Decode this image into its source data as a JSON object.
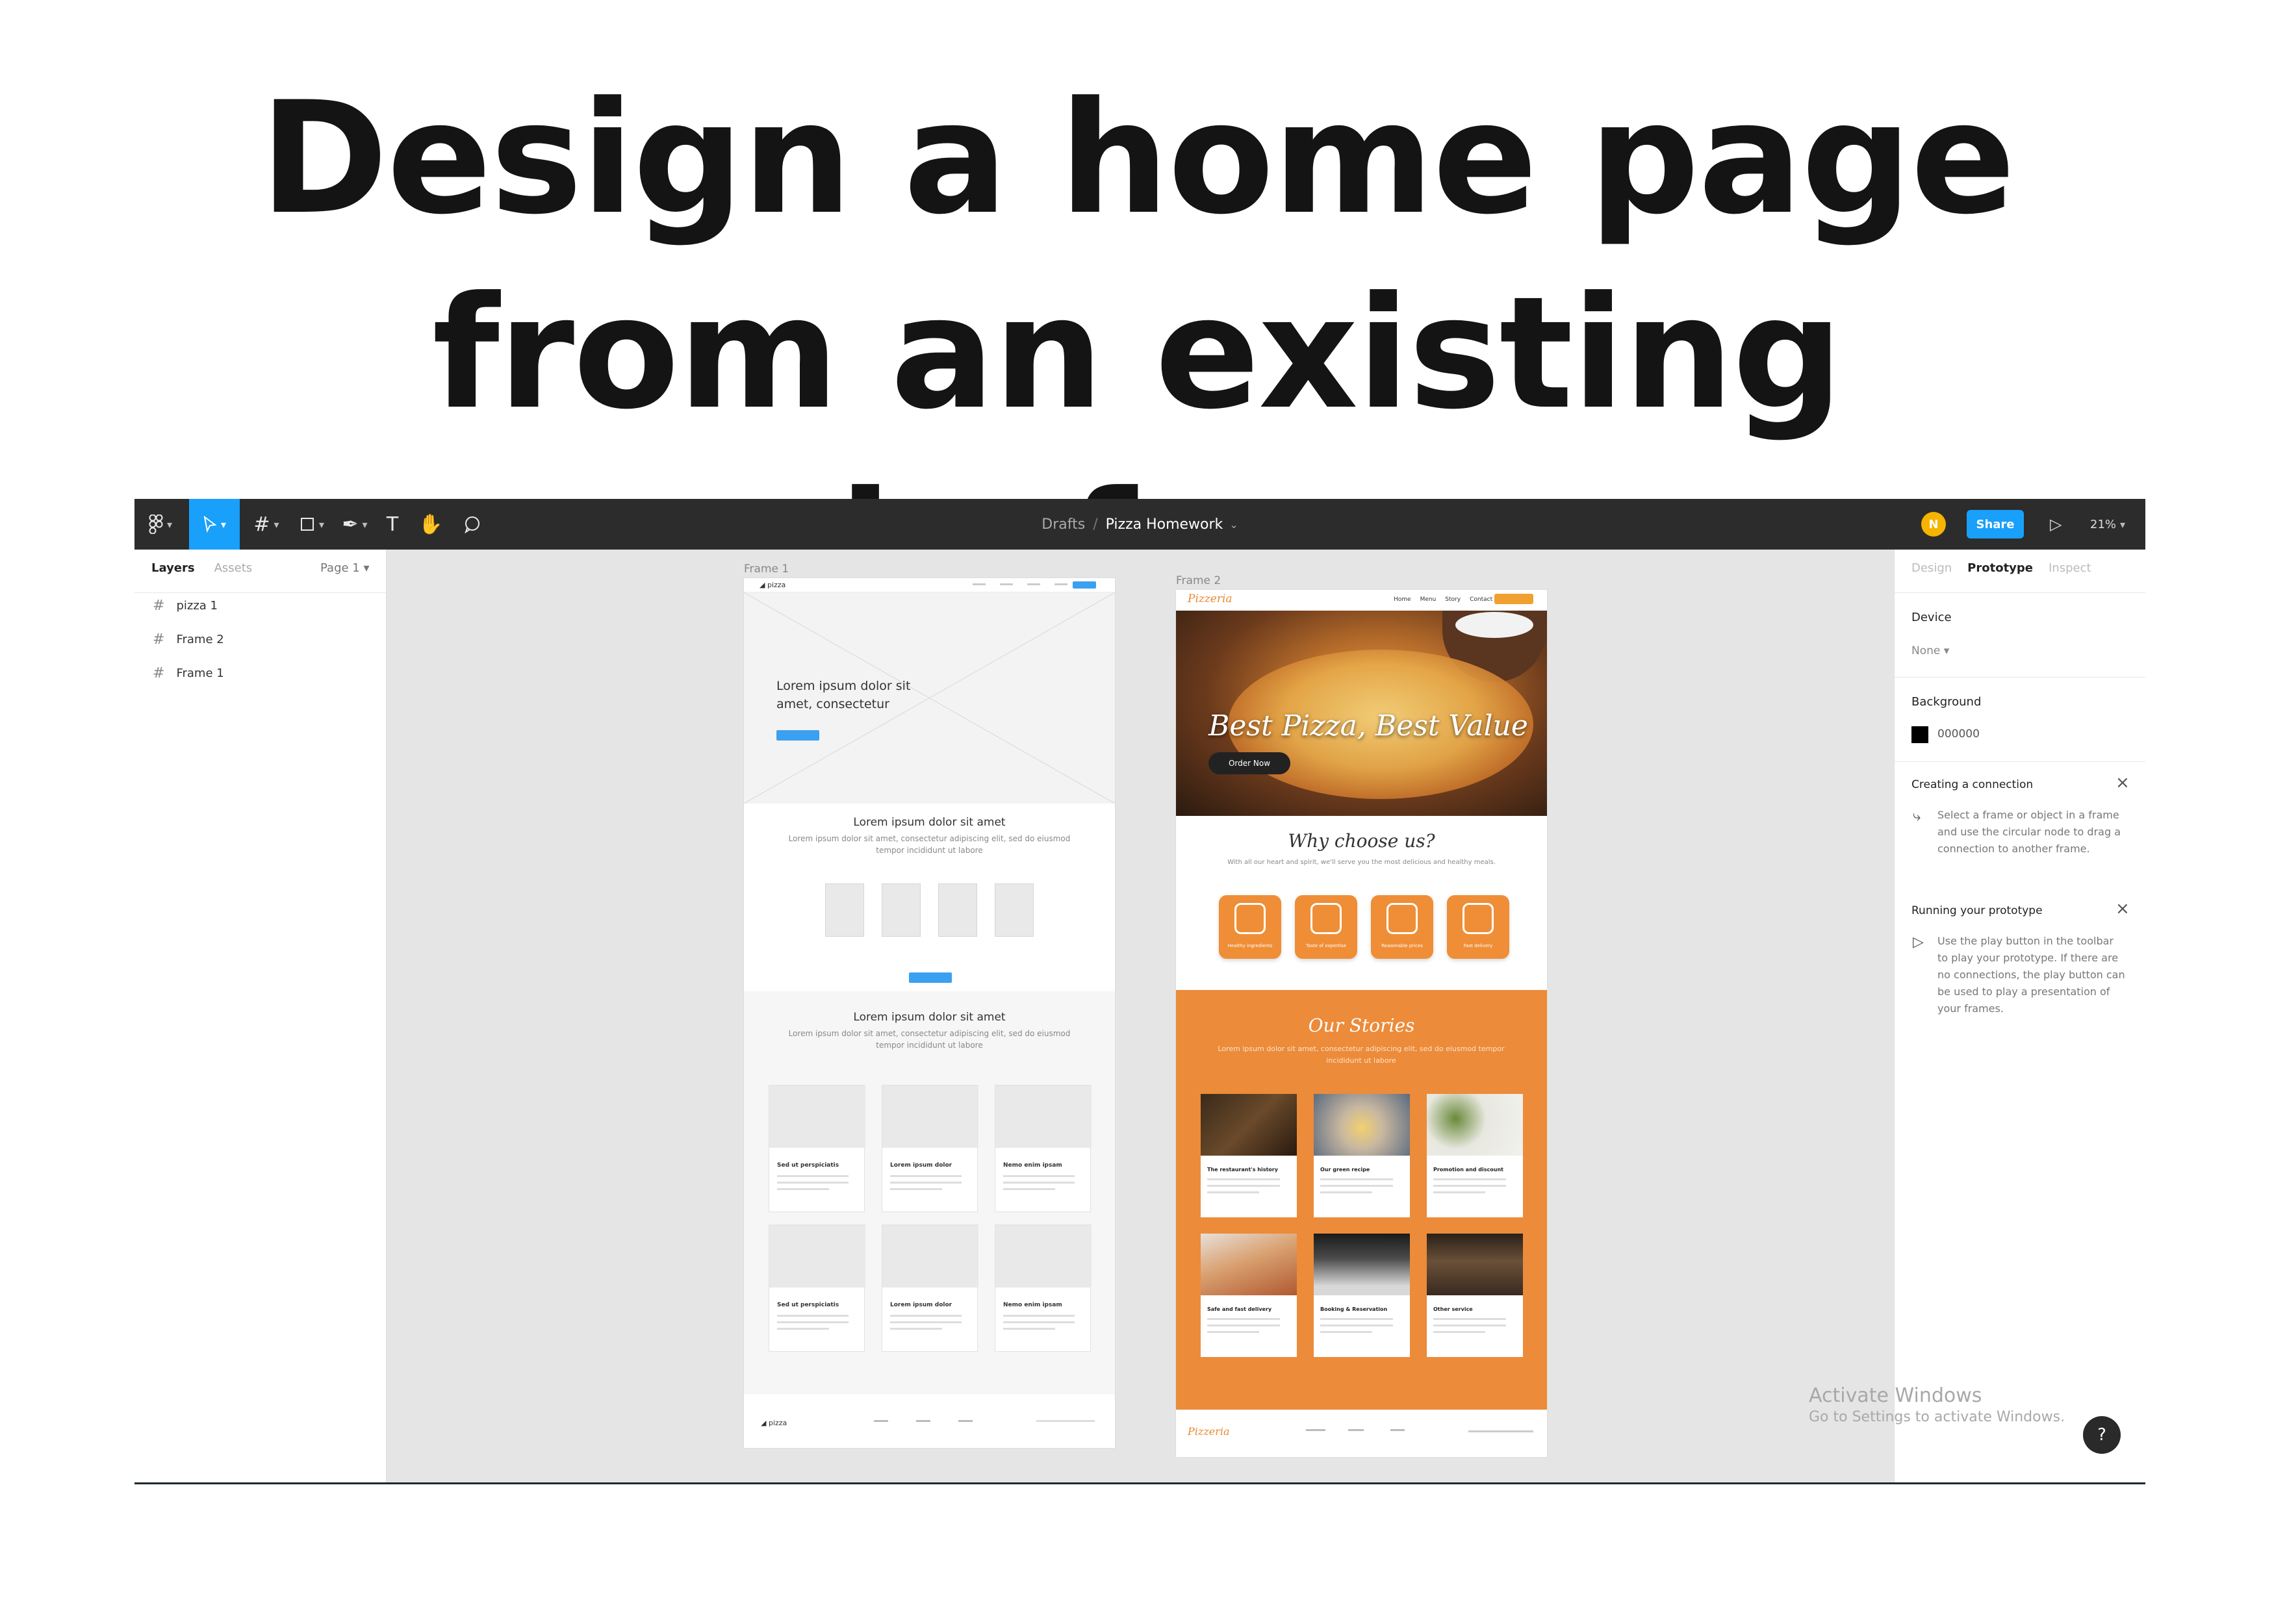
{
  "headline": {
    "line1": "Design a home page",
    "line2": "from an existing wireframe"
  },
  "toolbar": {
    "breadcrumb_root": "Drafts",
    "breadcrumb_sep": "/",
    "file_name": "Pizza Homework",
    "file_chevron": "⌄",
    "avatar_initial": "N",
    "share_label": "Share",
    "zoom": "21%",
    "tools": [
      "figma-menu-icon",
      "move-tool-icon",
      "frame-tool-icon",
      "shape-tool-icon",
      "pen-tool-icon",
      "text-tool-icon",
      "hand-tool-icon",
      "comment-tool-icon"
    ]
  },
  "left_panel": {
    "tab_layers": "Layers",
    "tab_assets": "Assets",
    "page": "Page 1",
    "layers": [
      "pizza 1",
      "Frame 2",
      "Frame 1"
    ]
  },
  "right_panel": {
    "tab_design": "Design",
    "tab_prototype": "Prototype",
    "tab_inspect": "Inspect",
    "device_label": "Device",
    "device_value": "None",
    "background_label": "Background",
    "background_value": "000000",
    "connection_title": "Creating a connection",
    "connection_text": "Select a frame or object in a frame and use the circular node to drag a connection to another frame.",
    "running_title": "Running your prototype",
    "running_text": "Use the play button in the toolbar to play your prototype. If there are no connections, the play button can be used to play a presentation of your frames."
  },
  "canvas": {
    "frame1_label": "Frame 1",
    "frame2_label": "Frame 2",
    "wireframe": {
      "logo": "◢ pizza",
      "hero_text": "Lorem ipsum dolor sit amet, consectetur",
      "section1_heading": "Lorem ipsum dolor sit amet",
      "section1_text": "Lorem ipsum dolor sit amet, consectetur adipiscing elit, sed do eiusmod tempor incididunt ut labore",
      "section2_heading": "Lorem ipsum dolor sit amet",
      "section2_text": "Lorem ipsum dolor sit amet, consectetur adipiscing elit, sed do eiusmod tempor incididunt ut labore",
      "cards": [
        "Sed ut perspiciatis",
        "Lorem ipsum dolor",
        "Nemo enim ipsam",
        "Sed ut perspiciatis",
        "Lorem ipsum dolor",
        "Nemo enim ipsam"
      ],
      "footer_logo": "◢ pizza"
    },
    "design": {
      "logo": "Pizzeria",
      "nav_links": [
        "Home",
        "Menu",
        "Story",
        "Contact"
      ],
      "hero_title": "Best Pizza, Best Value",
      "order_button": "Order Now",
      "why_title": "Why choose us?",
      "why_text": "With all our heart and spirit, we'll serve you the most delicious and healthy meals.",
      "features": [
        "Healthy ingredients",
        "Taste of expertise",
        "Reasonable prices",
        "Fast delivery"
      ],
      "stores_title": "Our Stories",
      "stores_text": "Lorem ipsum dolor sit amet, consectetur adipiscing elit, sed do eiusmod tempor incididunt ut labore",
      "story_cards": [
        "The restaurant's history",
        "Our green recipe",
        "Promotion and discount",
        "Safe and fast delivery",
        "Booking & Reservation",
        "Other service"
      ],
      "footer_logo": "Pizzeria"
    }
  },
  "watermark": {
    "line1": "Activate Windows",
    "line2": "Go to Settings to activate Windows."
  },
  "help_button": "?",
  "colors": {
    "accent_blue": "#18a0fb",
    "toolbar_bg": "#2c2c2c",
    "brand_orange": "#ec8b3a",
    "avatar_yellow": "#f5b400"
  }
}
